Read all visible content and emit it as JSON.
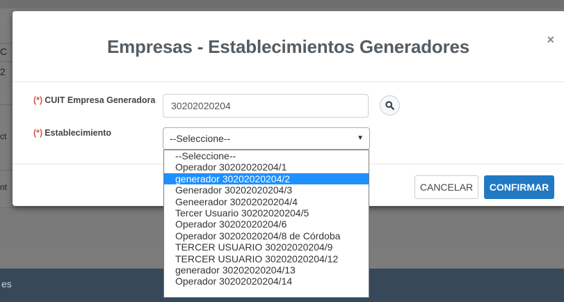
{
  "background": {
    "fragment_1": "C",
    "fragment_2": "2",
    "fragment_3": "ct",
    "fragment_4": "nt",
    "footer_text": "es"
  },
  "modal": {
    "title": "Empresas - Establecimientos Generadores",
    "close_label": "×",
    "required_marker": "(*)",
    "cuit_label": "CUIT Empresa Generadora",
    "cuit_value": "30202020204",
    "establecimiento_label": "Establecimiento",
    "select_value": "--Seleccione--",
    "cancel_label": "CANCELAR",
    "confirm_label": "CONFIRMAR"
  },
  "dropdown": {
    "selected_index": 2,
    "options": [
      "--Seleccione--",
      "Operador 30202020204/1",
      "generador 30202020204/2",
      "Generador 30202020204/3",
      "Geneerador 30202020204/4",
      "Tercer Usuario 30202020204/5",
      "Operador 30202020204/6",
      "Operador 30202020204/8 de Córdoba",
      "TERCER USUARIO 30202020204/9",
      "TERCER USUARIO 30202020204/12",
      "generador 30202020204/13",
      "Operador 30202020204/14"
    ]
  },
  "colors": {
    "primary": "#2179c4",
    "highlight": "#1e90ff",
    "required": "#d9534f"
  }
}
